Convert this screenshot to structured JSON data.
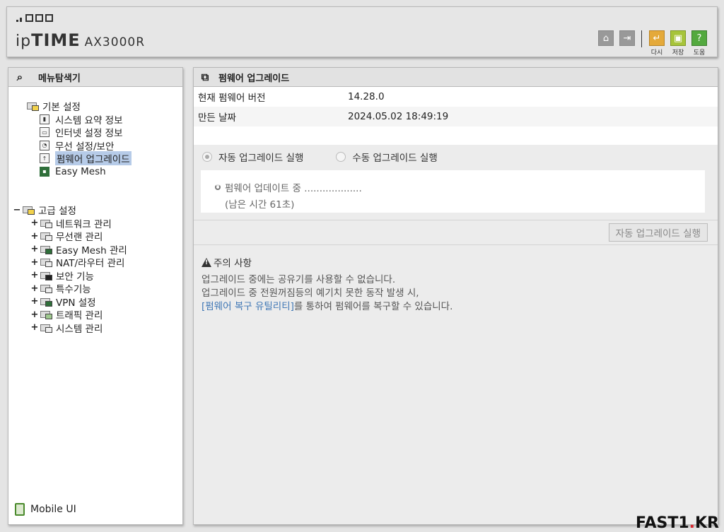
{
  "header": {
    "logo_ip": "ip",
    "logo_time": "TIME",
    "model": "AX3000R",
    "buttons": [
      {
        "icon": "home-icon",
        "label": ""
      },
      {
        "icon": "logout-icon",
        "label": ""
      },
      {
        "icon": "undo-icon",
        "label": "다시",
        "color": "#e4a93a"
      },
      {
        "icon": "save-icon",
        "label": "저장",
        "color": "#a7c43a"
      },
      {
        "icon": "help-icon",
        "label": "도움",
        "color": "#53a93f"
      }
    ]
  },
  "sidebar": {
    "title": "메뉴탐색기",
    "basic": {
      "label": "기본 설정",
      "items": [
        "시스템 요약 정보",
        "인터넷 설정 정보",
        "무선 설정/보안",
        "펌웨어 업그레이드",
        "Easy Mesh"
      ]
    },
    "advanced": {
      "label": "고급 설정",
      "toggle": "−",
      "items": [
        "네트워크 관리",
        "무선랜 관리",
        "Easy Mesh 관리",
        "NAT/라우터 관리",
        "보안 기능",
        "특수기능",
        "VPN 설정",
        "트래픽 관리",
        "시스템 관리"
      ]
    },
    "mobile_ui": "Mobile UI"
  },
  "main": {
    "title": "펌웨어 업그레이드",
    "info": {
      "version_label": "현재 펌웨어 버전",
      "version_value": "14.28.0",
      "date_label": "만든 날짜",
      "date_value": "2024.05.02 18:49:19"
    },
    "radios": {
      "auto": "자동 업그레이드 실행",
      "manual": "수동 업그레이드 실행",
      "selected": "auto"
    },
    "progress": {
      "line1": "펌웨어 업데이트 중 ...................",
      "line2": "(남은 시간 61초)"
    },
    "action_button": "자동 업그레이드 실행",
    "caution": {
      "title": "주의 사항",
      "line1": "업그레이드 중에는 공유기를 사용할 수 없습니다.",
      "line2": "업그레이드 중 전원꺼짐등의 예기치 못한 동작 발생 시,",
      "link": "[펌웨어 복구 유틸리티]",
      "line3_rest": "를 통하여 펌웨어를 복구할 수 있습니다."
    }
  },
  "watermark": {
    "text": "FAST1",
    "dot": ".",
    "suffix": "KR"
  },
  "colors": {
    "accent_link": "#3f77b5",
    "selected_bg": "#b6cbe8"
  }
}
